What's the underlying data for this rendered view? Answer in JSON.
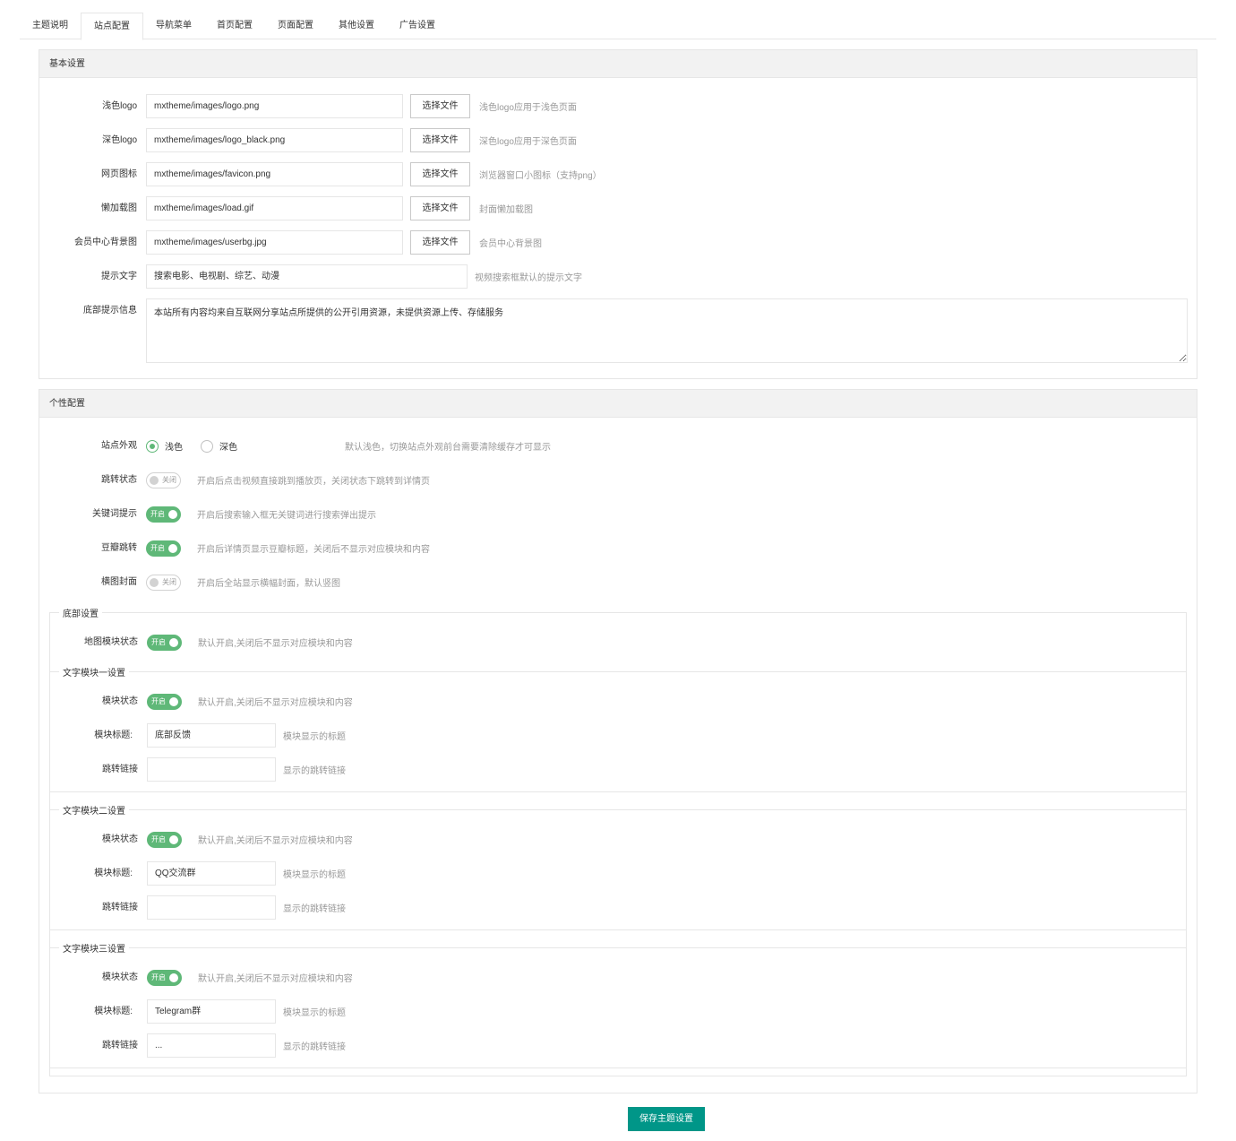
{
  "tabs": [
    "主题说明",
    "站点配置",
    "导航菜单",
    "首页配置",
    "页面配置",
    "其他设置",
    "广告设置"
  ],
  "active_tab": "站点配置",
  "basic": {
    "title": "基本设置",
    "file_button": "选择文件",
    "light_logo": {
      "label": "浅色logo",
      "value": "mxtheme/images/logo.png",
      "hint": "浅色logo应用于浅色页面"
    },
    "dark_logo": {
      "label": "深色logo",
      "value": "mxtheme/images/logo_black.png",
      "hint": "深色logo应用于深色页面"
    },
    "favicon": {
      "label": "网页图标",
      "value": "mxtheme/images/favicon.png",
      "hint": "浏览器窗口小图标（支持png）"
    },
    "lazyload": {
      "label": "懒加载图",
      "value": "mxtheme/images/load.gif",
      "hint": "封面懒加载图"
    },
    "userbg": {
      "label": "会员中心背景图",
      "value": "mxtheme/images/userbg.jpg",
      "hint": "会员中心背景图"
    },
    "search_hint": {
      "label": "提示文字",
      "value": "搜索电影、电视剧、综艺、动漫",
      "hint": "视频搜索框默认的提示文字"
    },
    "footer_notice": {
      "label": "底部提示信息",
      "value": "本站所有内容均来自互联网分享站点所提供的公开引用资源，未提供资源上传、存储服务"
    }
  },
  "personal": {
    "title": "个性配置",
    "appearance": {
      "label": "站点外观",
      "opt_light": "浅色",
      "opt_dark": "深色",
      "hint": "默认浅色，切换站点外观前台需要清除缓存才可显示"
    },
    "jump": {
      "label": "跳转状态",
      "state": "关闭",
      "hint": "开启后点击视频直接跳到播放页，关闭状态下跳转到详情页"
    },
    "keyword": {
      "label": "关键词提示",
      "state": "开启",
      "hint": "开启后搜索输入框无关键词进行搜索弹出提示"
    },
    "douban": {
      "label": "豆瓣跳转",
      "state": "开启",
      "hint": "开启后详情页显示豆瓣标题，关闭后不显示对应模块和内容"
    },
    "banner": {
      "label": "横图封面",
      "state": "关闭",
      "hint": "开启后全站显示横幅封面，默认竖图"
    },
    "footer": {
      "title": "底部设置",
      "map": {
        "label": "地图模块状态",
        "state": "开启",
        "hint": "默认开启,关闭后不显示对应模块和内容"
      },
      "status_label": "模块状态",
      "status_hint": "默认开启,关闭后不显示对应模块和内容",
      "title_label": "模块标题:",
      "title_hint": "模块显示的标题",
      "link_label": "跳转链接",
      "link_hint": "显示的跳转链接",
      "block1": {
        "title": "文字模块一设置",
        "state": "开启",
        "name": "底部反馈",
        "link": ""
      },
      "block2": {
        "title": "文字模块二设置",
        "state": "开启",
        "name": "QQ交流群",
        "link": ""
      },
      "block3": {
        "title": "文字模块三设置",
        "state": "开启",
        "name": "Telegram群",
        "link": "..."
      }
    }
  },
  "save_button": "保存主题设置",
  "colors": {
    "switch_on": "#5FB878",
    "save_button": "#009688"
  }
}
